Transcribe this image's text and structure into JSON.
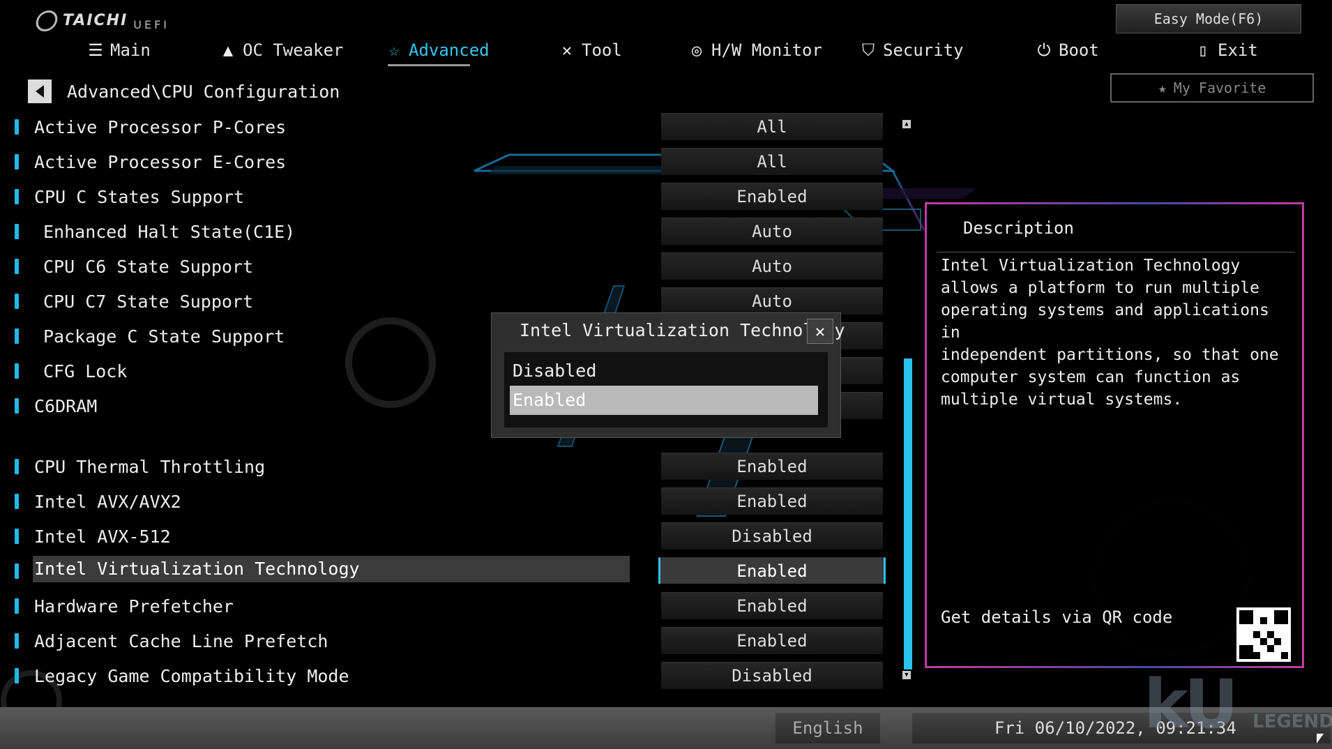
{
  "brand": {
    "name": "TAICHI",
    "sub": "UEFI"
  },
  "easy_mode_label": "Easy Mode(F6)",
  "favorite_label": "My Favorite",
  "nav": [
    {
      "label": "Main",
      "icon": "list-icon"
    },
    {
      "label": "OC Tweaker",
      "icon": "rocket-icon"
    },
    {
      "label": "Advanced",
      "icon": "star-icon",
      "active": true
    },
    {
      "label": "Tool",
      "icon": "tools-icon"
    },
    {
      "label": "H/W Monitor",
      "icon": "gauge-icon"
    },
    {
      "label": "Security",
      "icon": "shield-icon"
    },
    {
      "label": "Boot",
      "icon": "power-icon"
    },
    {
      "label": "Exit",
      "icon": "exit-icon"
    }
  ],
  "breadcrumb": "Advanced\\CPU Configuration",
  "settings": [
    {
      "label": "Active Processor P-Cores",
      "value": "All"
    },
    {
      "label": "Active Processor E-Cores",
      "value": "All"
    },
    {
      "label": "CPU C States Support",
      "value": "Enabled"
    },
    {
      "label": "Enhanced Halt State(C1E)",
      "value": "Auto"
    },
    {
      "label": "CPU C6 State Support",
      "value": "Auto"
    },
    {
      "label": "CPU C7 State Support",
      "value": "Auto"
    },
    {
      "label": "Package C State Support",
      "value": ""
    },
    {
      "label": "CFG Lock",
      "value": ""
    },
    {
      "label": "C6DRAM",
      "value": ""
    },
    {
      "label": "CPU Thermal Throttling",
      "value": "Enabled"
    },
    {
      "label": "Intel AVX/AVX2",
      "value": "Enabled"
    },
    {
      "label": "Intel AVX-512",
      "value": "Disabled"
    },
    {
      "label": "Intel Virtualization Technology",
      "value": "Enabled",
      "selected": true
    },
    {
      "label": "Hardware Prefetcher",
      "value": "Enabled"
    },
    {
      "label": "Adjacent Cache Line Prefetch",
      "value": "Enabled"
    },
    {
      "label": "Legacy Game Compatibility Mode",
      "value": "Disabled"
    }
  ],
  "popup": {
    "title": "Intel Virtualization Technology",
    "options": [
      "Disabled",
      "Enabled"
    ],
    "selected": "Enabled"
  },
  "description": {
    "title": "Description",
    "text": "Intel Virtualization Technology\nallows a platform to run multiple\noperating systems and applications in\nindependent partitions, so that one\ncomputer system can function as\nmultiple virtual systems.",
    "qr_label": "Get details via QR code"
  },
  "footer": {
    "language": "English",
    "datetime": "Fri 06/10/2022, 09:21:34"
  },
  "watermark": {
    "text": "kU",
    "sub": "LEGEND"
  },
  "colors": {
    "accent": "#2ac4ef",
    "panel_border": "#c23aa4",
    "selected_row": "#3b3b3b"
  }
}
